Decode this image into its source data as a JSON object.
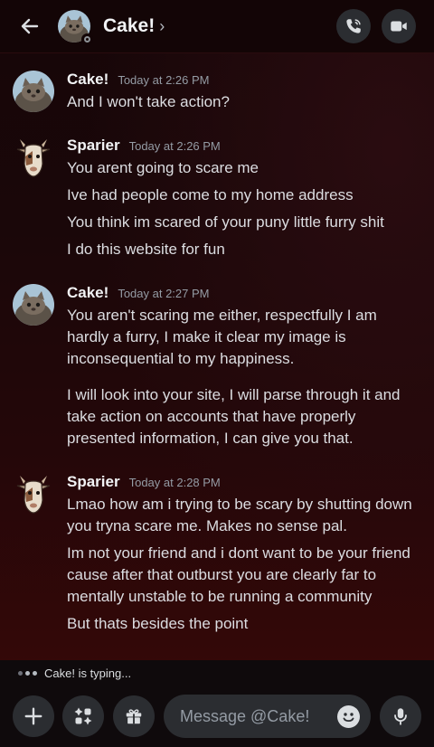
{
  "header": {
    "title": "Cake!",
    "chevron": "›"
  },
  "messages": [
    {
      "author": "Cake!",
      "time": "Today at 2:26 PM",
      "avatar": "cat-avatar",
      "lines": [
        "And I won't take action?"
      ]
    },
    {
      "author": "Sparier",
      "time": "Today at 2:26 PM",
      "avatar": "goat-avatar",
      "lines": [
        "You arent going to scare me",
        "Ive had people come to my home address",
        "You think im scared of your puny little furry shit",
        "I do this website for fun"
      ]
    },
    {
      "author": "Cake!",
      "time": "Today at 2:27 PM",
      "avatar": "cat-avatar",
      "paragraphs": [
        "You aren't scaring me either, respectfully I am hardly a furry, I make it clear my image is inconsequential to my happiness.",
        "I will look into your site, I will parse through it and take action on accounts that have properly presented information, I can give you that."
      ]
    },
    {
      "author": "Sparier",
      "time": "Today at 2:28 PM",
      "avatar": "goat-avatar",
      "lines": [
        "Lmao how am i trying to be scary by shutting down you tryna scare me. Makes no sense pal.",
        "Im not your friend and i dont want to be your friend cause after that outburst you are clearly far to mentally unstable to be running a community",
        "But thats besides the point"
      ]
    }
  ],
  "typing": {
    "text": "Cake! is typing..."
  },
  "composer": {
    "placeholder": "Message @Cake!"
  }
}
